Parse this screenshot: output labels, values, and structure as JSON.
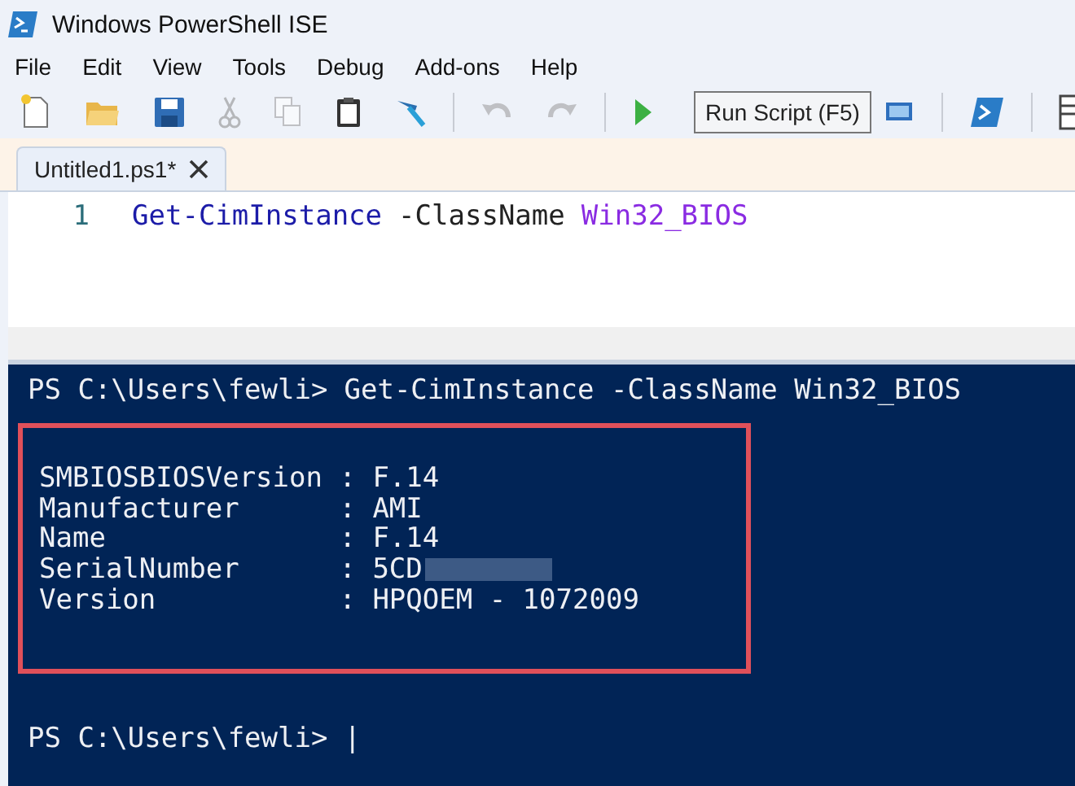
{
  "window": {
    "title": "Windows PowerShell ISE"
  },
  "menu": [
    "File",
    "Edit",
    "View",
    "Tools",
    "Debug",
    "Add-ons",
    "Help"
  ],
  "toolbar": {
    "buttons": [
      {
        "kind": "new",
        "disabled": false
      },
      {
        "kind": "open",
        "disabled": false
      },
      {
        "kind": "save",
        "disabled": false
      },
      {
        "kind": "cut",
        "disabled": true
      },
      {
        "kind": "copy",
        "disabled": true
      },
      {
        "kind": "paste",
        "disabled": false
      },
      {
        "kind": "clear",
        "disabled": false
      },
      {
        "kind": "sep"
      },
      {
        "kind": "undo",
        "disabled": true
      },
      {
        "kind": "redo",
        "disabled": true
      },
      {
        "kind": "sep"
      },
      {
        "kind": "run",
        "disabled": false
      },
      {
        "kind": "remote",
        "disabled": false
      },
      {
        "kind": "sep"
      },
      {
        "kind": "powershell",
        "disabled": false
      },
      {
        "kind": "sep"
      },
      {
        "kind": "layout",
        "disabled": false
      }
    ],
    "tooltip": "Run Script (F5)"
  },
  "tabs": [
    {
      "label": "Untitled1.ps1*",
      "selected": true
    }
  ],
  "editor": {
    "lines": [
      {
        "number": "1",
        "tokens": [
          {
            "text": "Get-CimInstance",
            "kind": "command"
          },
          {
            "text": "-ClassName",
            "kind": "parameter"
          },
          {
            "text": "Win32_BIOS",
            "kind": "argument"
          }
        ]
      }
    ]
  },
  "console": {
    "command_prompt": "PS C:\\Users\\fewli>",
    "command": "Get-CimInstance -ClassName Win32_BIOS",
    "highlighted": true,
    "properties": [
      {
        "name": "SMBIOSBIOSVersion",
        "value": ": F.14",
        "redacted": false
      },
      {
        "name": "Manufacturer",
        "value": ": AMI",
        "redacted": false
      },
      {
        "name": "Name",
        "value": ": F.14",
        "redacted": false
      },
      {
        "name": "SerialNumber",
        "value": ": 5CD",
        "redacted": true
      },
      {
        "name": "Version",
        "value": ": HPQOEM - 1072009",
        "redacted": false
      }
    ],
    "prompt": "PS C:\\Users\\fewli>",
    "cursor": "|"
  }
}
